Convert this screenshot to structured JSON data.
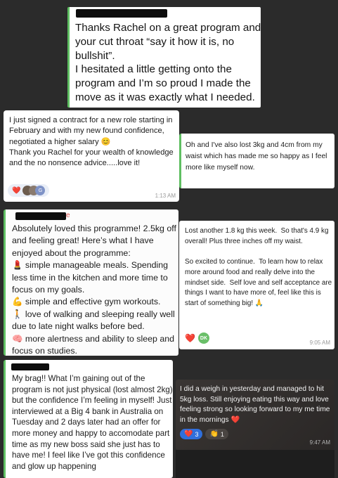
{
  "messages": [
    {
      "text": "Thanks Rachel on a great program and your cut throat “say it how it is, no bullshit”.\nI hesitated a little getting onto the program and I’m so proud I made the move as it was exactly what I needed."
    },
    {
      "text": "I just signed a contract for a new role starting in February and with my new found confidence,  negotiated a higher salary 😊\nThank you Rachel for your wealth of knowledge and the no nonsence advice.....love it!",
      "reactions": {
        "heart": "❤️",
        "avatar_initial": "G"
      },
      "time": "1:13 AM"
    },
    {
      "text": "Oh and I've also lost 3kg and 4cm from my waist which has made me so happy as I feel\nmore like myself now."
    },
    {
      "sender_tail": "e",
      "text": "Absolutely loved this programme! 2.5kg off and feeling great! Here’s what I have enjoyed about the programme:\n💄 simple manageable meals. Spending less time in the kitchen and more time to focus on my goals.\n💪 simple and effective gym workouts.\n🚶 love of walking and sleeping really well due to late night walks before bed.\n🧠 more alertness and ability to sleep and focus on studies."
    },
    {
      "text": "Lost another 1.8 kg this week.  So that's 4.9 kg overall! Plus three inches off my waist.\n\nSo excited to continue.  To learn how to relax more around food and really delve into the mindset side.  Self love and self acceptance are things I want to have more of, feel like this is start of something big! 🙏",
      "reactions": {
        "heart": "❤️",
        "avatar_initial": "DK"
      },
      "time": "9:05 AM"
    },
    {
      "text": "My brag!! What I’m gaining out of the program is not just physical (lost almost 2kg) but the confidence I’m feeling in myself! Just interviewed at a Big 4 bank in Australia on Tuesday and 2 days later had an offer for more money and happy to accomodate part time as my new boss said she just has to have me! I feel like I’ve got this confidence and glow up happening"
    },
    {
      "text": "I did a weigh in yesterday and managed to hit 5kg loss. Still enjoying eating this way and love feeling strong so looking forward to my me time in the mornings ❤️",
      "reactions": {
        "heart": "❤️",
        "heart_count": "3",
        "clap": "👏",
        "clap_count": "1"
      },
      "time": "9:47 AM"
    }
  ],
  "colors": {
    "background": "#2b2b2b",
    "bubble": "#ffffff",
    "accent_green": "#5fbf62",
    "dk_avatar": "#6abf69",
    "dark_bubble": "#2f2c2b",
    "reaction_blue": "#3b82f6"
  }
}
